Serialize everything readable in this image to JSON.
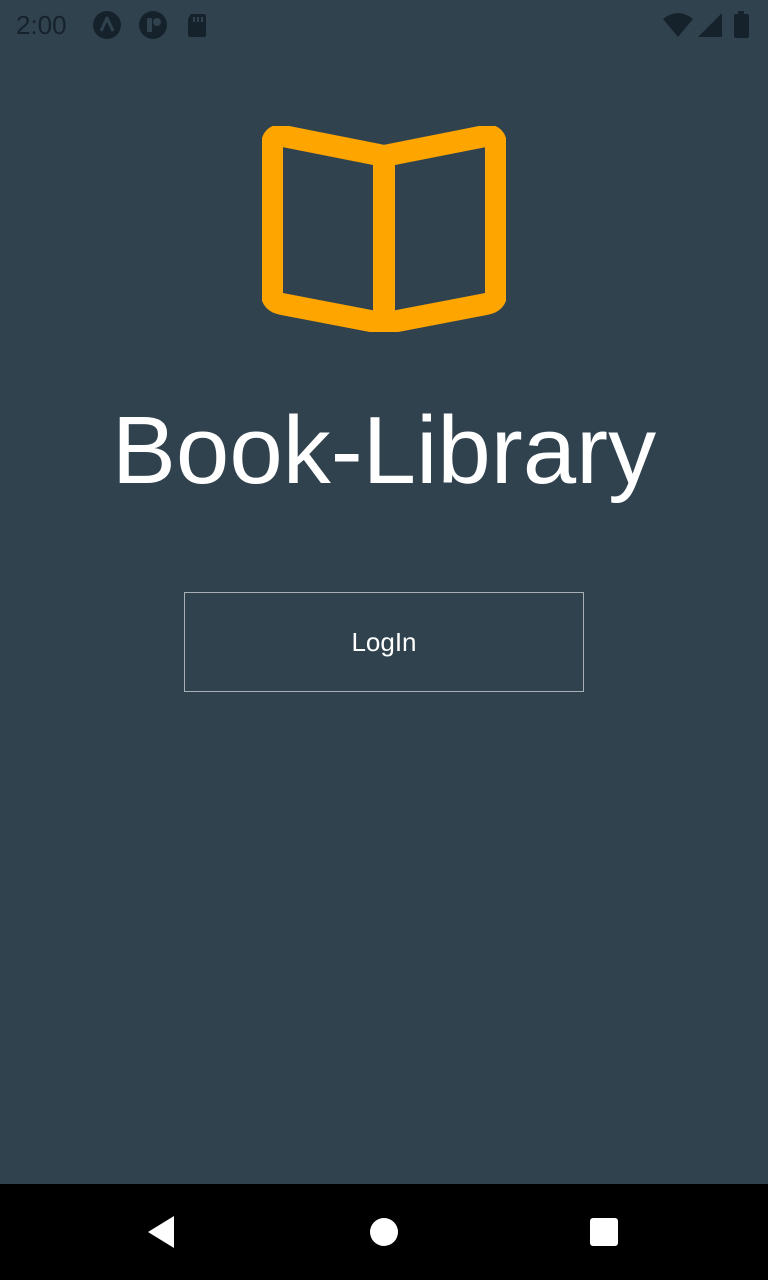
{
  "status_bar": {
    "time": "2:00",
    "left_icons": [
      "android-auto-icon",
      "app-notification-icon",
      "sd-card-icon"
    ],
    "right_icons": [
      "wifi-icon",
      "cellular-signal-icon",
      "battery-icon"
    ]
  },
  "app": {
    "logo_icon": "open-book-icon",
    "logo_color": "#ffa500",
    "title": "Book-Library",
    "login_label": "LogIn",
    "background_color": "#31424f"
  },
  "nav_bar": {
    "buttons": [
      "back-icon",
      "home-icon",
      "recents-icon"
    ]
  }
}
